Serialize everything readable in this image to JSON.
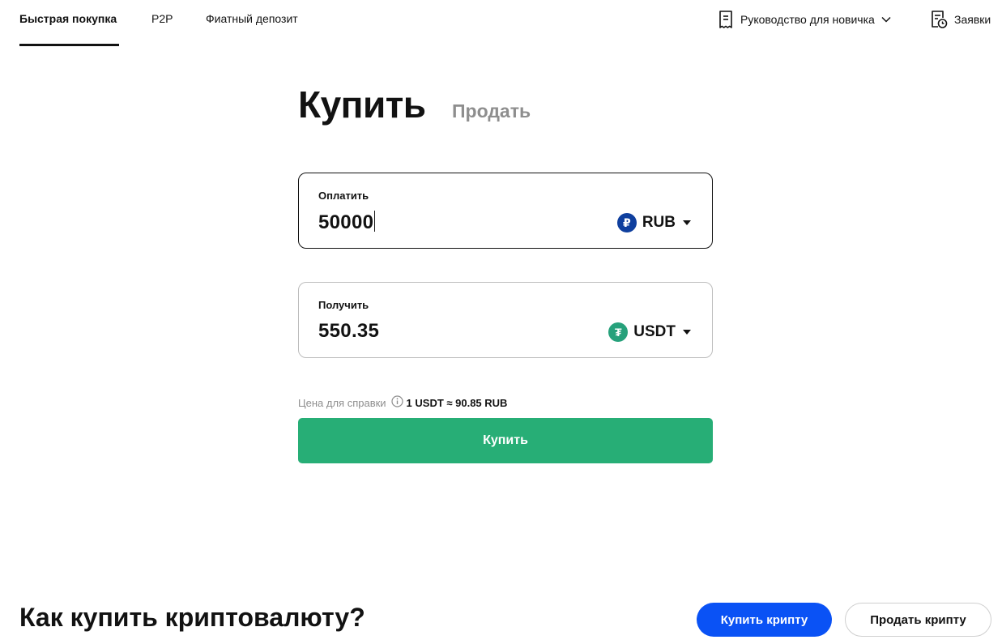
{
  "nav": {
    "tabs": [
      {
        "label": "Быстрая покупка",
        "active": true
      },
      {
        "label": "P2P",
        "active": false
      },
      {
        "label": "Фиатный депозит",
        "active": false
      }
    ],
    "guide_label": "Руководство для новичка",
    "orders_label": "Заявки",
    "icons": {
      "guide": "document-icon",
      "orders": "orders-clock-icon",
      "chevron": "chevron-down-icon"
    }
  },
  "trade": {
    "buy_label": "Купить",
    "sell_label": "Продать",
    "pay": {
      "label": "Оплатить",
      "value": "50000",
      "currency": "RUB",
      "currency_symbol": "₽",
      "currency_color": "#0f3f9e"
    },
    "receive": {
      "label": "Получить",
      "value": "550.35",
      "currency": "USDT",
      "currency_symbol": "₮",
      "currency_color": "#26a17b"
    },
    "reference_label": "Цена для справки",
    "reference_value": "1 USDT ≈ 90.85 RUB",
    "submit_label": "Купить",
    "submit_color": "#27ae76"
  },
  "bottom": {
    "title": "Как купить криптовалюту?",
    "buy_crypto_label": "Купить крипту",
    "sell_crypto_label": "Продать крипту",
    "buy_crypto_color": "#0a52f5"
  }
}
